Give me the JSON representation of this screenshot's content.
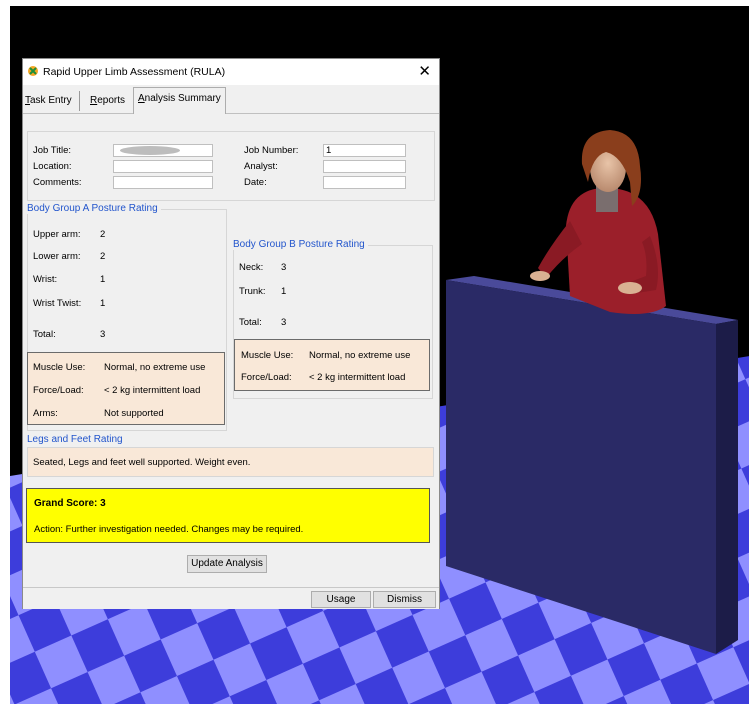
{
  "window": {
    "title": "Rapid Upper Limb Assessment (RULA)",
    "close_glyph": "✕"
  },
  "tabs": [
    {
      "first": "T",
      "rest": "ask Entry"
    },
    {
      "first": "R",
      "rest": "eports"
    },
    {
      "first": "A",
      "rest": "nalysis Summary"
    }
  ],
  "job_info": {
    "job_title_label": "Job Title:",
    "job_title_value": "",
    "location_label": "Location:",
    "location_value": "",
    "comments_label": "Comments:",
    "comments_value": "",
    "job_number_label": "Job Number:",
    "job_number_value": "1",
    "analyst_label": "Analyst:",
    "analyst_value": "",
    "date_label": "Date:",
    "date_value": ""
  },
  "group_a": {
    "title": "Body Group A Posture Rating",
    "rows": [
      {
        "label": "Upper arm:",
        "value": "2"
      },
      {
        "label": "Lower arm:",
        "value": "2"
      },
      {
        "label": "Wrist:",
        "value": "1"
      },
      {
        "label": "Wrist Twist:",
        "value": "1"
      }
    ],
    "total_label": "Total:",
    "total_value": "3",
    "muscle_label": "Muscle Use:",
    "muscle_value": "Normal, no extreme use",
    "force_label": "Force/Load:",
    "force_value": "< 2 kg intermittent load",
    "arms_label": "Arms:",
    "arms_value": "Not supported"
  },
  "group_b": {
    "title": "Body Group B Posture Rating",
    "rows": [
      {
        "label": "Neck:",
        "value": "3"
      },
      {
        "label": "Trunk:",
        "value": "1"
      }
    ],
    "total_label": "Total:",
    "total_value": "3",
    "muscle_label": "Muscle Use:",
    "muscle_value": "Normal, no extreme use",
    "force_label": "Force/Load:",
    "force_value": "< 2 kg intermittent load"
  },
  "legs": {
    "title": "Legs and Feet Rating",
    "text": "Seated, Legs and feet well supported.  Weight even."
  },
  "grand": {
    "score_text": "Grand Score: 3",
    "action_text": "Action:  Further investigation needed.  Changes may be required."
  },
  "buttons": {
    "update": "Update Analysis",
    "usage": "Usage",
    "dismiss": "Dismiss"
  },
  "colors": {
    "group_title": "#2255cc",
    "peach_panel": "#f9e8d8",
    "score_panel": "#ffff00",
    "floor_light": "#8f8fff",
    "floor_dark": "#3d3ddb",
    "counter": "#26265c",
    "shirt": "#9b1f2a"
  }
}
